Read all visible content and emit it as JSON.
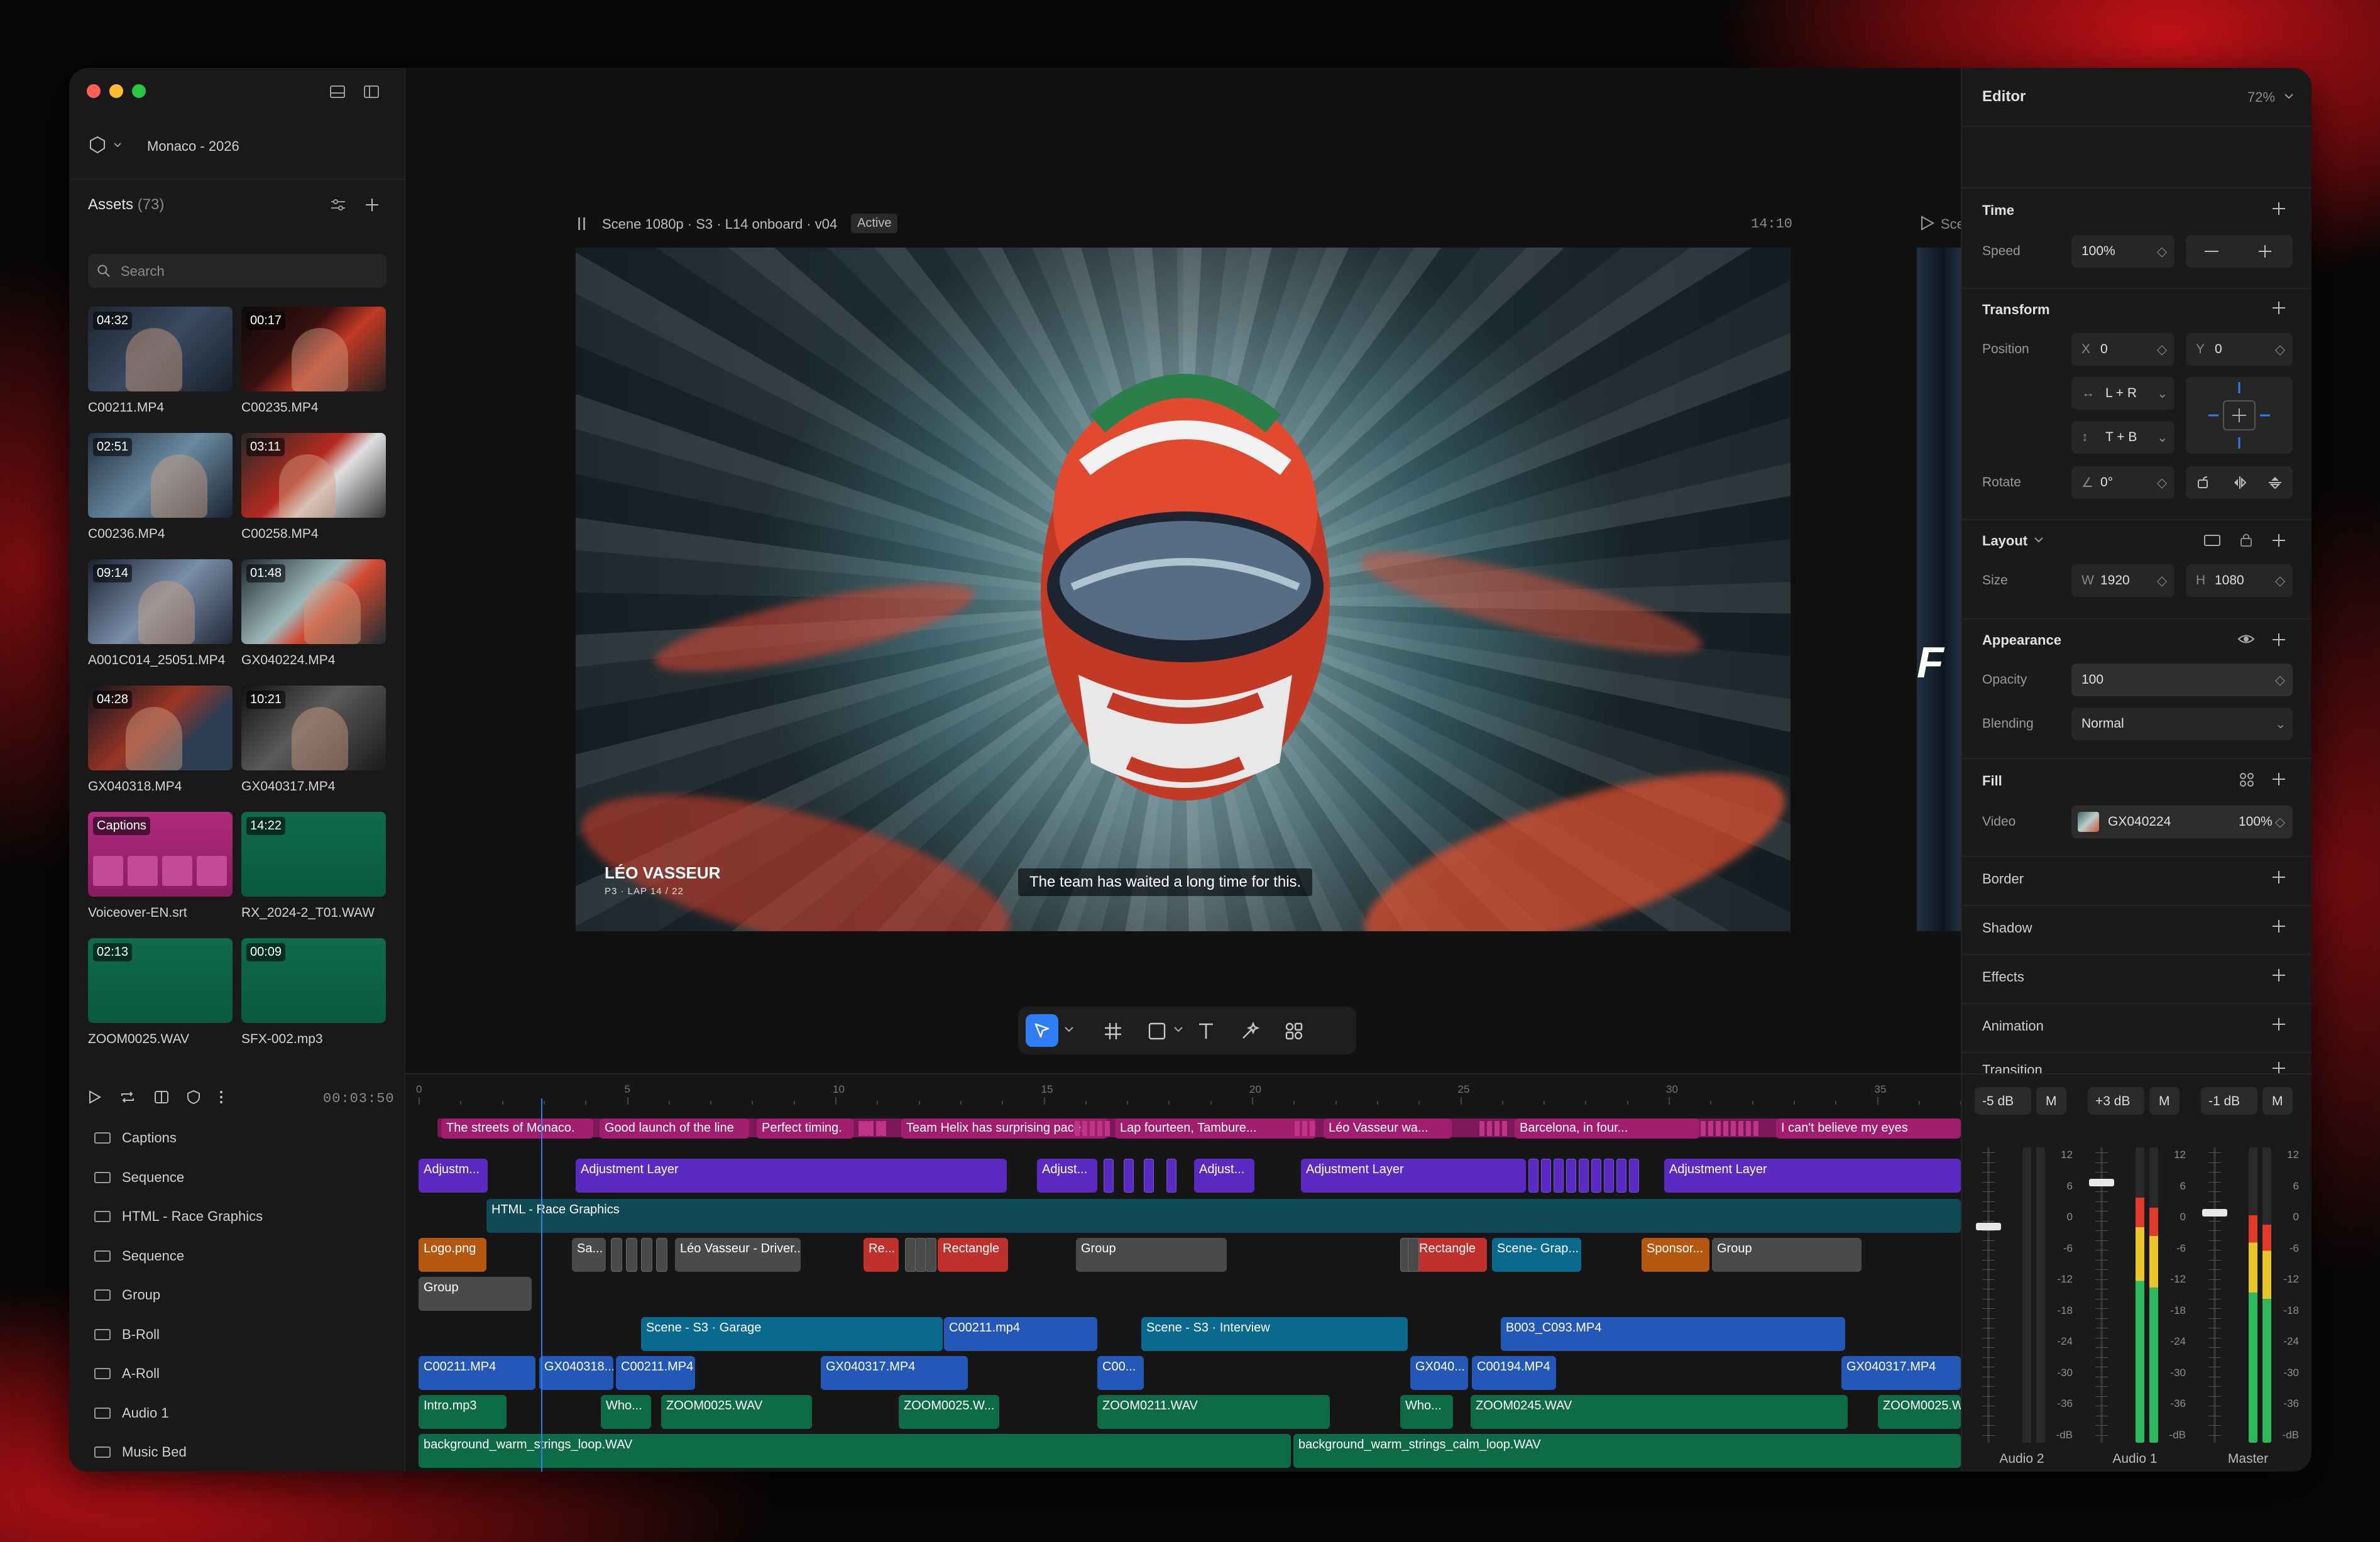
{
  "project": {
    "name": "Monaco - 2026"
  },
  "assets": {
    "title": "Assets",
    "count": "(73)",
    "search_placeholder": "Search",
    "items": [
      {
        "duration": "04:32",
        "name": "C00211.MP4"
      },
      {
        "duration": "00:17",
        "name": "C00235.MP4"
      },
      {
        "duration": "02:51",
        "name": "C00236.MP4"
      },
      {
        "duration": "03:11",
        "name": "C00258.MP4"
      },
      {
        "duration": "09:14",
        "name": "A001C014_25051.MP4"
      },
      {
        "duration": "01:48",
        "name": "GX040224.MP4"
      },
      {
        "duration": "04:28",
        "name": "GX040318.MP4"
      },
      {
        "duration": "10:21",
        "name": "GX040317.MP4"
      },
      {
        "duration": "Captions",
        "name": "Voiceover-EN.srt"
      },
      {
        "duration": "14:22",
        "name": "RX_2024-2_T01.WAW"
      },
      {
        "duration": "02:13",
        "name": "ZOOM0025.WAV"
      },
      {
        "duration": "00:09",
        "name": "SFX-002.mp3"
      }
    ]
  },
  "viewer": {
    "scene_label": "Scene 1080p · S3 · L14 onboard · v04",
    "badge": "Active",
    "timecode": "14:10",
    "next_scene": "Sce",
    "lower_third_name": "LÉO VASSEUR",
    "lower_third_sub": "P3 · LAP 14 / 22",
    "subtitle": "The team has waited a long time for this."
  },
  "editor": {
    "title": "Editor",
    "zoom": "72%",
    "time": {
      "label": "Time",
      "speed_label": "Speed",
      "speed": "100%"
    },
    "transform": {
      "label": "Transform",
      "position_label": "Position",
      "x_label": "X",
      "x": "0",
      "y_label": "Y",
      "y": "0",
      "h_constraint": "L + R",
      "v_constraint": "T + B",
      "rotate_label": "Rotate",
      "rotate": "0°"
    },
    "layout": {
      "label": "Layout",
      "size_label": "Size",
      "w_label": "W",
      "w": "1920",
      "h_label": "H",
      "h": "1080"
    },
    "appearance": {
      "label": "Appearance",
      "opacity_label": "Opacity",
      "opacity": "100",
      "blending_label": "Blending",
      "blending": "Normal"
    },
    "fill": {
      "label": "Fill",
      "video_label": "Video",
      "video_source": "GX040224",
      "video_opacity": "100%"
    },
    "border": "Border",
    "shadow": "Shadow",
    "effects": "Effects",
    "animation": "Animation",
    "transition": "Transition"
  },
  "timeline": {
    "timecode": "00:03:50",
    "ruler": [
      "0",
      "5",
      "10",
      "15",
      "20",
      "25",
      "30",
      "35"
    ],
    "tracks": [
      "Captions",
      "Sequence",
      "HTML - Race Graphics",
      "Sequence",
      "Group",
      "B-Roll",
      "A-Roll",
      "Audio 1",
      "Music Bed"
    ],
    "clips": {
      "captions": [
        "The streets of Monaco.",
        "Good launch of the line",
        "Perfect timing.",
        "Team Helix has surprising pace.",
        "Lap fourteen, Tambure...",
        "Léo Vasseur wa...",
        "Barcelona, in four...",
        "I can't believe my eyes"
      ],
      "adjust": [
        "Adjustm...",
        "Adjustment Layer",
        "Adjust...",
        "Adjust...",
        "Adjustment Layer",
        "Adjustment Layer"
      ],
      "html": "HTML - Race Graphics",
      "seq2": [
        "Logo.png",
        "Sa...",
        "Léo Vasseur - Driver...",
        "Re...",
        "Rectangle",
        "Group",
        "Rectangle",
        "Scene- Grap...",
        "Sponsor...",
        "Group"
      ],
      "group": "Group",
      "broll": [
        "Scene - S3 · Garage",
        "C00211.mp4",
        "Scene - S3 · Interview",
        "B003_C093.MP4"
      ],
      "aroll": [
        "C00211.MP4",
        "GX040318...",
        "C00211.MP4",
        "GX040317.MP4",
        "C00...",
        "GX040...",
        "C00194.MP4",
        "GX040317.MP4"
      ],
      "audio1": [
        "Intro.mp3",
        "Who...",
        "ZOOM0025.WAV",
        "ZOOM0025.W...",
        "ZOOM0211.WAV",
        "Who...",
        "ZOOM0245.WAV",
        "ZOOM0025.W..."
      ],
      "music": [
        "background_warm_strings_loop.WAV",
        "background_warm_strings_calm_loop.WAV"
      ]
    }
  },
  "mixer": {
    "channels": [
      {
        "gain": "-5 dB",
        "mute": "M",
        "name": "Audio 2",
        "level": 0.0
      },
      {
        "gain": "+3 dB",
        "mute": "M",
        "name": "Audio 1",
        "level": 0.83
      },
      {
        "gain": "-1 dB",
        "mute": "M",
        "name": "Master",
        "level": 0.77
      }
    ],
    "scale": [
      "12",
      "6",
      "0",
      "-6",
      "-12",
      "-18",
      "-24",
      "-30",
      "-36",
      "-dB"
    ]
  },
  "colors": {
    "accent": "#2f7ef6",
    "captions": "#a11d6d",
    "adjustment": "#5b2ac2",
    "audio": "#0d6b48",
    "broll": "#2357b8",
    "scene": "#0a6a8e"
  }
}
